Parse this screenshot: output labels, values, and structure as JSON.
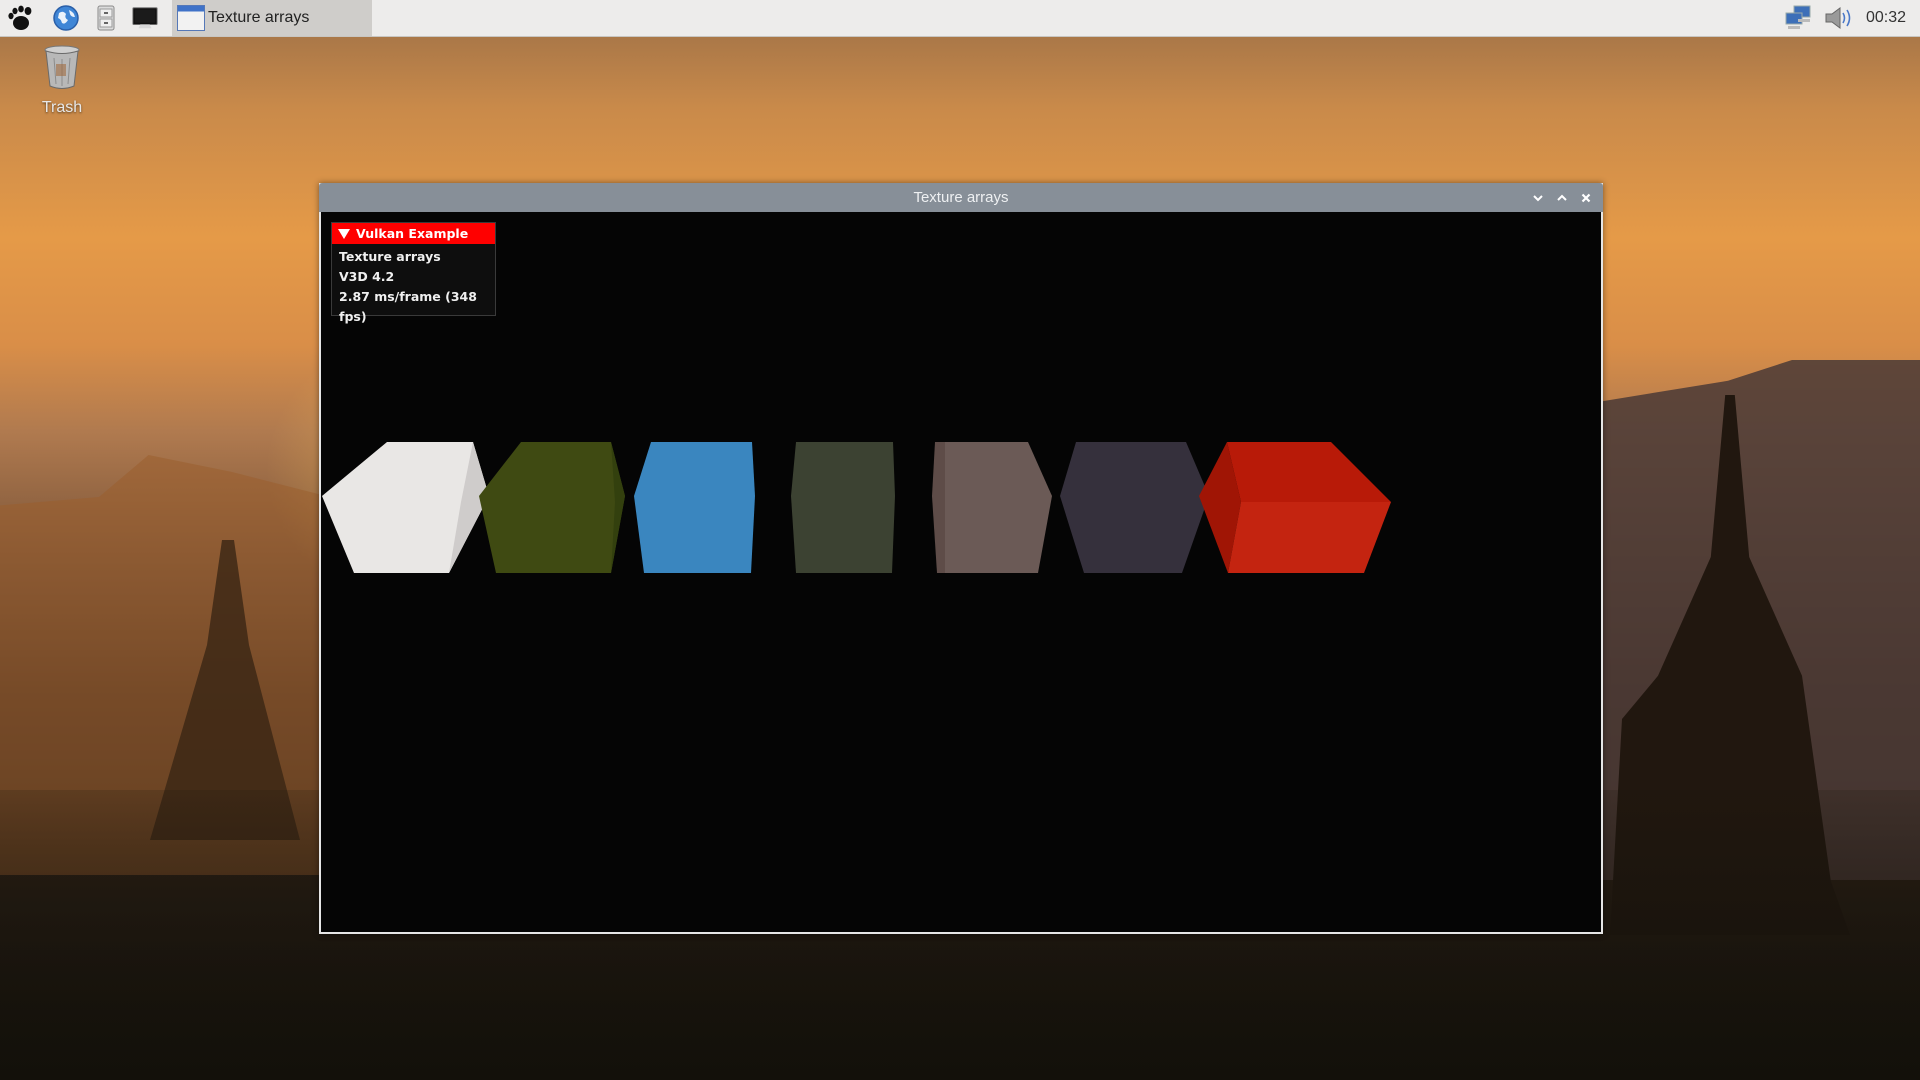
{
  "taskbar": {
    "launchers": [
      {
        "name": "menu",
        "icon": "gnome-foot-icon"
      },
      {
        "name": "web-browser",
        "icon": "globe-icon"
      },
      {
        "name": "file-manager",
        "icon": "filing-cabinet-icon"
      },
      {
        "name": "terminal",
        "icon": "monitor-icon"
      }
    ],
    "active_window_label": "Texture arrays",
    "tray": {
      "network_icon": "network-icon",
      "volume_icon": "speaker-icon",
      "clock": "00:32"
    }
  },
  "desktop": {
    "icons": [
      {
        "label": "Trash",
        "icon": "trash-icon"
      }
    ]
  },
  "window": {
    "title": "Texture arrays",
    "controls": {
      "minimize": "⌄",
      "maximize": "⌃",
      "close": "✕"
    },
    "overlay": {
      "header": "Vulkan Example",
      "lines": [
        "Texture arrays",
        "V3D 4.2",
        "2.87 ms/frame (348 fps)"
      ]
    },
    "cubes": [
      {
        "layer": 0,
        "texture": "snow",
        "colors": {
          "top": "#e9e7e5",
          "left": "#dcdad8",
          "right": "#cfcccb"
        }
      },
      {
        "layer": 1,
        "texture": "grass",
        "colors": {
          "top": "#3f4a12",
          "left": "#3a4410",
          "right": "#33400e"
        }
      },
      {
        "layer": 2,
        "texture": "water",
        "colors": {
          "top": "#3a86bf",
          "left": "#3680b8",
          "right": "#2f78ae"
        }
      },
      {
        "layer": 3,
        "texture": "moss-rock",
        "colors": {
          "top": "#3c4232",
          "left": "#373d2e",
          "right": "#32382a"
        }
      },
      {
        "layer": 4,
        "texture": "striped-rock",
        "colors": {
          "top": "#6b5a56",
          "left": "#5e4c48",
          "right": "#7d706c"
        }
      },
      {
        "layer": 5,
        "texture": "speckled-dark",
        "colors": {
          "top": "#35303c",
          "left": "#302b36",
          "right": "#2b2631"
        }
      },
      {
        "layer": 6,
        "texture": "lava",
        "colors": {
          "top": "#b81a08",
          "left": "#a01505",
          "right": "#c42410"
        }
      }
    ]
  }
}
